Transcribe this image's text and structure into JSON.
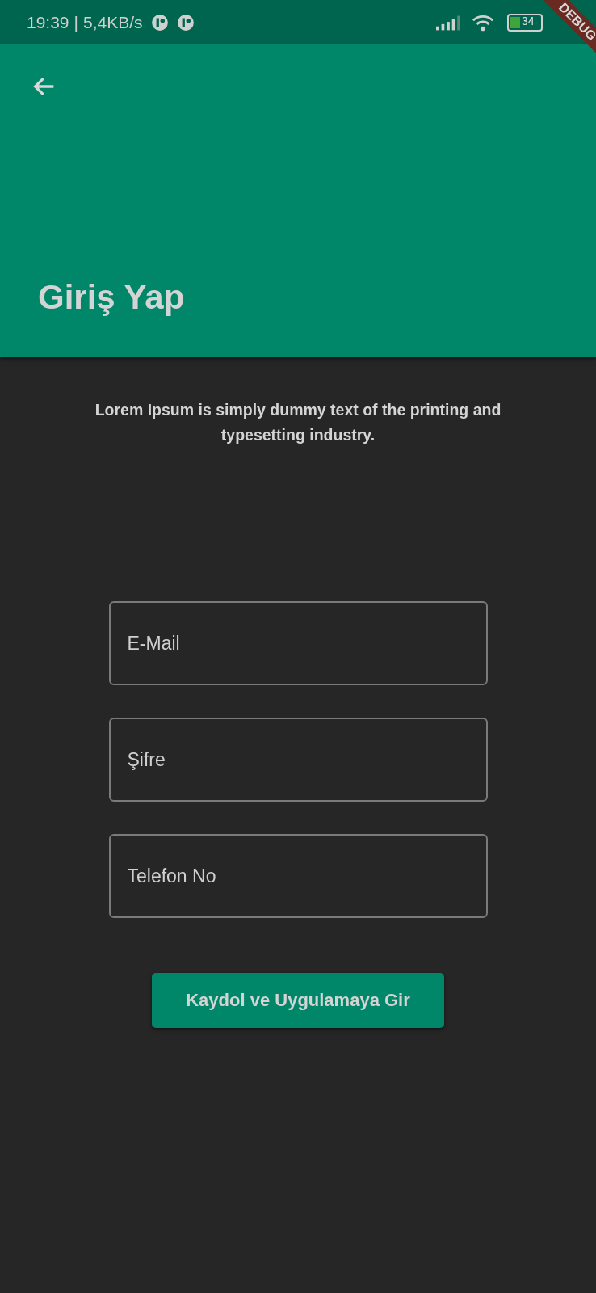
{
  "status_bar": {
    "time": "19:39",
    "separator": "|",
    "speed": "5,4KB/s",
    "battery": "34"
  },
  "debug_banner": "DEBUG",
  "app_bar": {
    "title": "Giriş Yap"
  },
  "intro": "Lorem Ipsum is simply dummy text of the printing and typesetting industry.",
  "fields": [
    {
      "placeholder": "E-Mail"
    },
    {
      "placeholder": "Şifre"
    },
    {
      "placeholder": "Telefon No"
    }
  ],
  "submit_button": "Kaydol ve Uygulamaya Gir"
}
